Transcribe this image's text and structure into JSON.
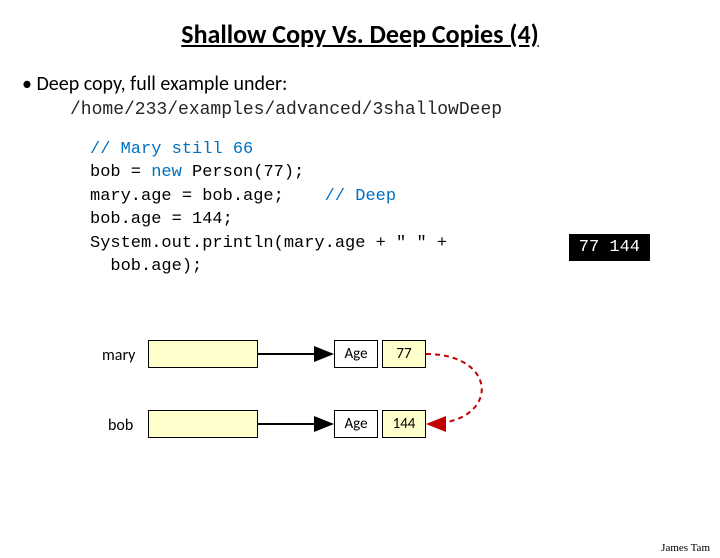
{
  "title": "Shallow Copy Vs. Deep Copies (4)",
  "bullet": "Deep copy, full example under:",
  "path": "/home/233/examples/advanced/3shallowDeep",
  "code": {
    "c1": "// Mary still 66",
    "l2a": "bob = ",
    "l2b": "new",
    "l2c": " Person(77);",
    "l3a": "mary.age = bob.age;    ",
    "l3b": "// Deep",
    "l4": "bob.age = 144;",
    "l5": "System.out.println(mary.age + \" \" +",
    "l6": "  bob.age);"
  },
  "console": "77 144",
  "diagram": {
    "mary_label": "mary",
    "bob_label": "bob",
    "age_label_1": "Age",
    "age_label_2": "Age",
    "val_top": "77",
    "val_bottom": "144"
  },
  "footer": "James Tam"
}
